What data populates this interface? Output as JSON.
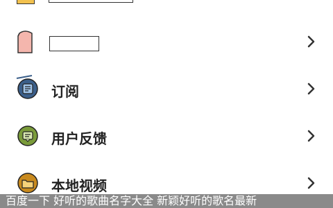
{
  "menu": {
    "items": [
      {
        "label": ""
      },
      {
        "label": ""
      },
      {
        "label": "订阅"
      },
      {
        "label": "用户反馈"
      },
      {
        "label": "本地视频"
      }
    ]
  },
  "toast": {
    "text": "百度一下 好听的歌曲名字大全 新颖好听的歌名最新"
  },
  "colors": {
    "subscribe_icon": "#3b5f8a",
    "feedback_icon": "#7a9b3a",
    "video_icon": "#c98a1e",
    "top_icon": "#f2c14e",
    "second_icon": "#f4b6ad"
  }
}
